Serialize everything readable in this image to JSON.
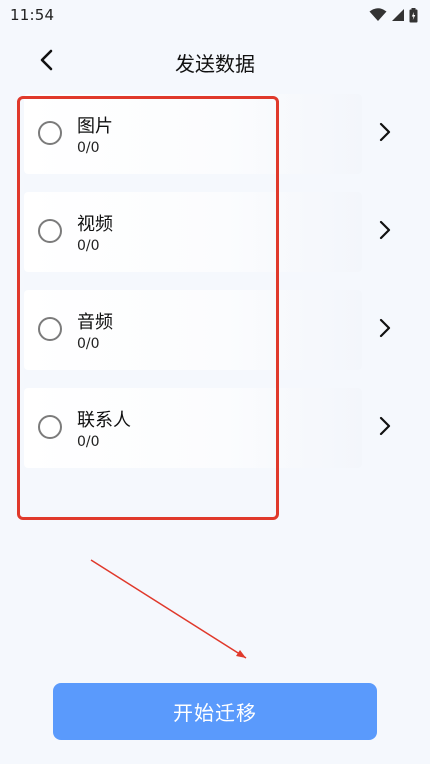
{
  "status_bar": {
    "time": "11:54",
    "icons": [
      "wifi-icon",
      "signal-icon",
      "battery-icon"
    ]
  },
  "header": {
    "title": "发送数据",
    "back_icon": "chevron-left-icon"
  },
  "items": [
    {
      "label": "图片",
      "count": "0/0"
    },
    {
      "label": "视频",
      "count": "0/0"
    },
    {
      "label": "音频",
      "count": "0/0"
    },
    {
      "label": "联系人",
      "count": "0/0"
    }
  ],
  "start_button": {
    "label": "开始迁移"
  },
  "colors": {
    "accent": "#5a9afc",
    "annotation": "#e0392b",
    "background": "#f5f8fd"
  }
}
